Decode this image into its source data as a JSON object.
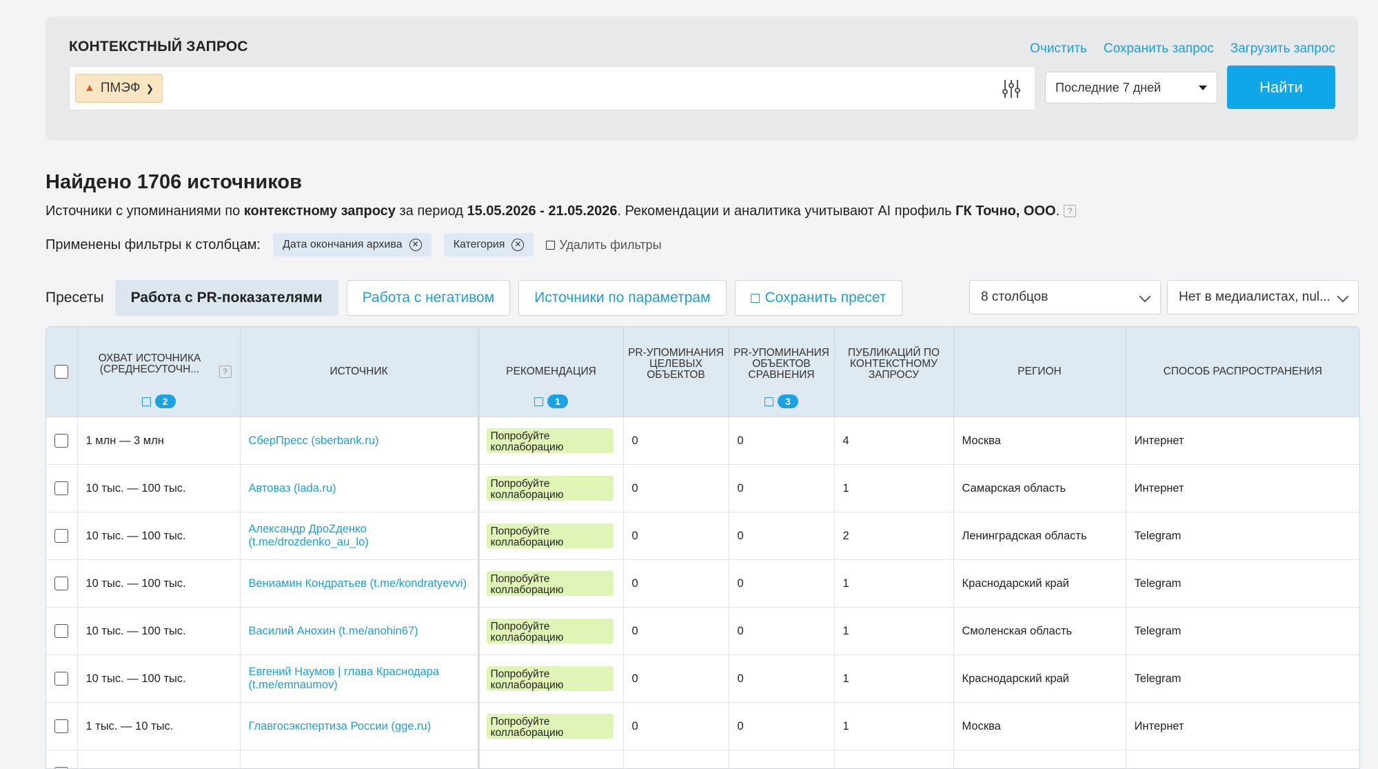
{
  "query": {
    "title": "КОНТЕКСТНЫЙ ЗАПРОС",
    "actions": {
      "clear": "Очистить",
      "save": "Сохранить запрос",
      "load": "Загрузить запрос"
    },
    "tag": "ПМЭФ",
    "period": "Последние 7 дней",
    "find_button": "Найти"
  },
  "results": {
    "title": "Найдено 1706 источников",
    "desc_1": "Источники с упоминаниями по ",
    "desc_bold_1": "контекстному запросу",
    "desc_2": " за период ",
    "desc_bold_2": "15.05.2026 - 21.05.2026",
    "desc_3": ". Рекомендации и аналитика учитывают AI профиль ",
    "desc_bold_3": "ГК Точно, ООО",
    "desc_4": ".",
    "filters_label": "Применены фильтры к столбцам:",
    "filters": [
      "Дата окончания архива",
      "Категория"
    ],
    "remove_filters": "Удалить фильтры"
  },
  "presets": {
    "label": "Пресеты",
    "items": [
      "Работа с PR-показателями",
      "Работа с негативом",
      "Источники по параметрам"
    ],
    "save": "Сохранить пресет",
    "columns_select": "8 столбцов",
    "media_select": "Нет в медиалистах, nul..."
  },
  "table": {
    "headers": {
      "reach": "ОХВАТ ИСТОЧНИКА (СРЕДНЕСУТОЧН...",
      "source": "ИСТОЧНИК",
      "recommendation": "РЕКОМЕНДАЦИЯ",
      "pr_target": "PR-УПОМИНАНИЯ ЦЕЛЕВЫХ ОБЪЕКТОВ",
      "pr_compare": "PR-УПОМИНАНИЯ ОБЪЕКТОВ СРАВНЕНИЯ",
      "publications": "ПУБЛИКАЦИЙ ПО КОНТЕКСТНОМУ ЗАПРОСУ",
      "region": "РЕГИОН",
      "distribution": "СПОСОБ РАСПРОСТРАНЕНИЯ"
    },
    "sort_badges": {
      "reach": "2",
      "recommendation": "1",
      "pr_compare": "3"
    },
    "rows": [
      {
        "reach": "1 млн — 3 млн",
        "source": "СберПресс (sberbank.ru)",
        "rec": "Попробуйте коллаборацию",
        "pr_target": "0",
        "pr_compare": "0",
        "pubs": "4",
        "region": "Москва",
        "dist": "Интернет"
      },
      {
        "reach": "10 тыс. — 100 тыс.",
        "source": "Автоваз (lada.ru)",
        "rec": "Попробуйте коллаборацию",
        "pr_target": "0",
        "pr_compare": "0",
        "pubs": "1",
        "region": "Самарская область",
        "dist": "Интернет"
      },
      {
        "reach": "10 тыс. — 100 тыс.",
        "source": "Александр ДроZденко (t.me/drozdenko_au_lo)",
        "rec": "Попробуйте коллаборацию",
        "pr_target": "0",
        "pr_compare": "0",
        "pubs": "2",
        "region": "Ленинградская область",
        "dist": "Telegram"
      },
      {
        "reach": "10 тыс. — 100 тыс.",
        "source": "Вениамин Кондратьев (t.me/kondratyevvi)",
        "rec": "Попробуйте коллаборацию",
        "pr_target": "0",
        "pr_compare": "0",
        "pubs": "1",
        "region": "Краснодарский край",
        "dist": "Telegram"
      },
      {
        "reach": "10 тыс. — 100 тыс.",
        "source": "Василий Анохин (t.me/anohin67)",
        "rec": "Попробуйте коллаборацию",
        "pr_target": "0",
        "pr_compare": "0",
        "pubs": "1",
        "region": "Смоленская область",
        "dist": "Telegram"
      },
      {
        "reach": "10 тыс. — 100 тыс.",
        "source": "Евгений Наумов | глава Краснодара (t.me/emnaumov)",
        "rec": "Попробуйте коллаборацию",
        "pr_target": "0",
        "pr_compare": "0",
        "pubs": "1",
        "region": "Краснодарский край",
        "dist": "Telegram"
      },
      {
        "reach": "1 тыс. — 10 тыс.",
        "source": "Главгосэкспертиза России (gge.ru)",
        "rec": "Попробуйте коллаборацию",
        "pr_target": "0",
        "pr_compare": "0",
        "pubs": "1",
        "region": "Москва",
        "dist": "Интернет"
      },
      {
        "reach": "",
        "source": "",
        "rec": "",
        "pr_target": "",
        "pr_compare": "",
        "pubs": "",
        "region": "",
        "dist": ""
      }
    ]
  }
}
